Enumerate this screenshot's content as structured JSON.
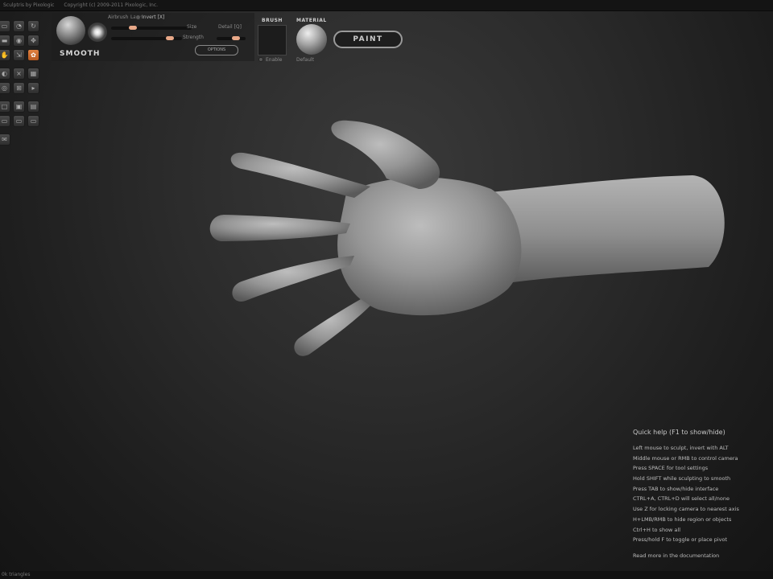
{
  "window": {
    "title": "Sculptris by Pixologic",
    "copyright": "Copyright (c) 2009-2011 Pixologic, Inc."
  },
  "toolbar": {
    "rows": [
      [
        "tool",
        "tool",
        "tool"
      ],
      [
        "tool",
        "tool",
        "tool"
      ],
      [
        "tool",
        "tool",
        "tool-active"
      ],
      [
        "tool",
        "tool",
        "tool"
      ],
      [
        "tool",
        "tool",
        "tool"
      ],
      [
        "tool",
        "tool",
        "tool"
      ],
      [
        "tool",
        "tool",
        "tool"
      ],
      [
        "tool"
      ]
    ]
  },
  "brush_panel": {
    "brush_name": "SMOOTH",
    "airbrush_label": "Airbrush",
    "lazy_label": "Lazy",
    "invert_label": "Invert [X]",
    "size_label": "Size",
    "detail_label": "Detail [Q]",
    "strength_label": "Strength",
    "options_label": "OPTIONS"
  },
  "brush_section": {
    "header": "BRUSH",
    "enable_label": "Enable"
  },
  "material_section": {
    "header": "MATERIAL",
    "name": "Default"
  },
  "paint_button": {
    "label": "PAINT"
  },
  "quick_help": {
    "title": "Quick help (F1 to show/hide)",
    "lines": [
      "Left mouse to sculpt, invert with ALT",
      "Middle mouse or RMB to control camera",
      "Press SPACE for tool settings",
      "Hold SHIFT while sculpting to smooth",
      "Press TAB to show/hide interface",
      "CTRL+A, CTRL+D will select all/none",
      "Use Z for locking camera to nearest axis",
      "H+LMB/RMB to hide region or objects",
      "Ctrl+H to show all",
      "Press/hold F to toggle or place pivot"
    ],
    "more": "Read more in the documentation"
  },
  "status": {
    "triangles": "0k triangles"
  },
  "viewport": {
    "object": "hand",
    "colors": {
      "mesh": "#9a9a9a",
      "background": "#2a2a2a"
    }
  }
}
